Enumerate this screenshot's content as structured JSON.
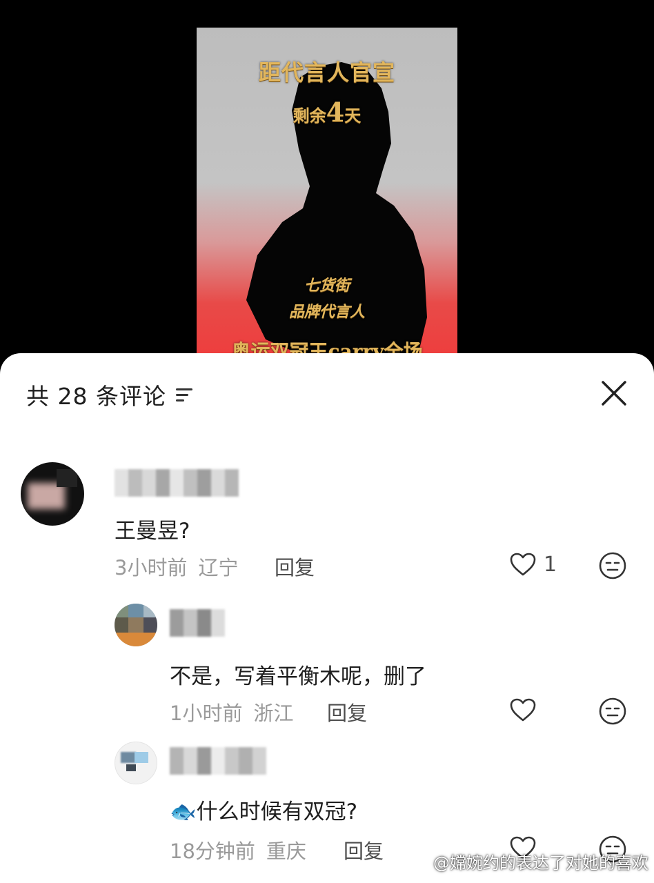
{
  "video": {
    "poster": {
      "headline": "距代言人官宣",
      "countdown_prefix": "剩余",
      "countdown_number": "4",
      "countdown_suffix": "天",
      "brand": "七货街",
      "role": "品牌代言人",
      "tagline": "奥运双冠王carry全场"
    }
  },
  "comments_panel": {
    "count_label": "共 28 条评论",
    "sort_icon": "sort-icon",
    "close_icon": "close-icon",
    "reply_label": "回复",
    "comments": [
      {
        "text": "王曼昱?",
        "time": "3小时前",
        "location": "辽宁",
        "likes": "1"
      },
      {
        "text": "不是，写着平衡木呢，删了",
        "time": "1小时前",
        "location": "浙江",
        "likes": ""
      },
      {
        "emoji": "🐟",
        "text": "什么时候有双冠?",
        "time": "18分钟前",
        "location": "重庆",
        "likes": ""
      }
    ]
  },
  "watermark": "@嫦婉约的表达了对她的喜欢"
}
